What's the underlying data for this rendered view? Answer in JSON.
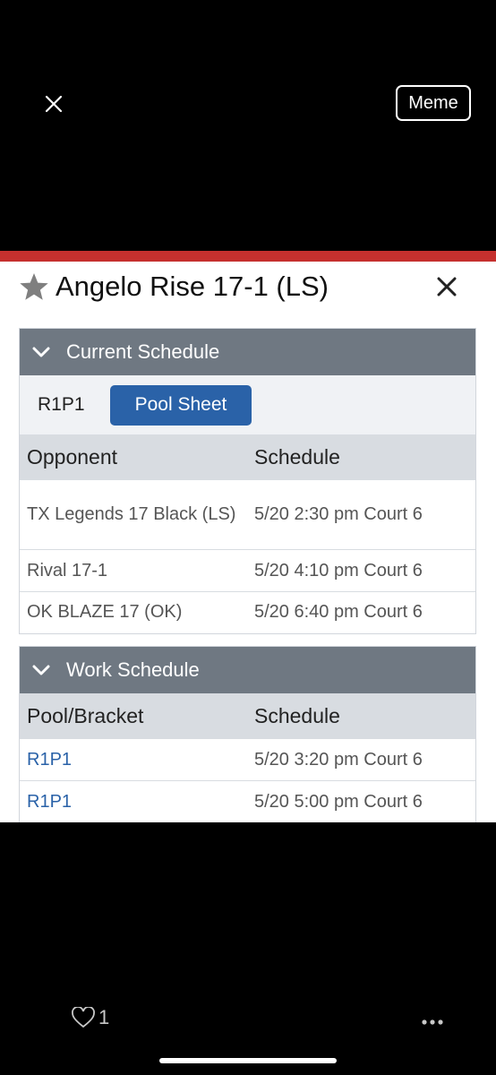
{
  "viewer": {
    "meme_label": "Meme",
    "like_count": "1"
  },
  "team": {
    "title": "Angelo Rise 17-1 (LS)"
  },
  "current_schedule": {
    "header": "Current Schedule",
    "pool": "R1P1",
    "pool_button": "Pool Sheet",
    "columns": [
      "Opponent",
      "Schedule"
    ],
    "rows": [
      {
        "opponent": "TX Legends 17 Black (LS)",
        "schedule": "5/20 2:30 pm Court 6"
      },
      {
        "opponent": "Rival 17-1",
        "schedule": "5/20 4:10 pm Court 6"
      },
      {
        "opponent": "OK BLAZE 17 (OK)",
        "schedule": "5/20 6:40 pm Court 6"
      }
    ]
  },
  "work_schedule": {
    "header": "Work Schedule",
    "columns": [
      "Pool/Bracket",
      "Schedule"
    ],
    "rows": [
      {
        "pool": "R1P1",
        "schedule": "5/20 3:20 pm Court 6"
      },
      {
        "pool": "R1P1",
        "schedule": "5/20 5:00 pm Court 6"
      }
    ]
  },
  "colors": {
    "header_bar": "#6f7882",
    "accent_blue": "#2a62a8",
    "top_red": "#c5302e"
  }
}
